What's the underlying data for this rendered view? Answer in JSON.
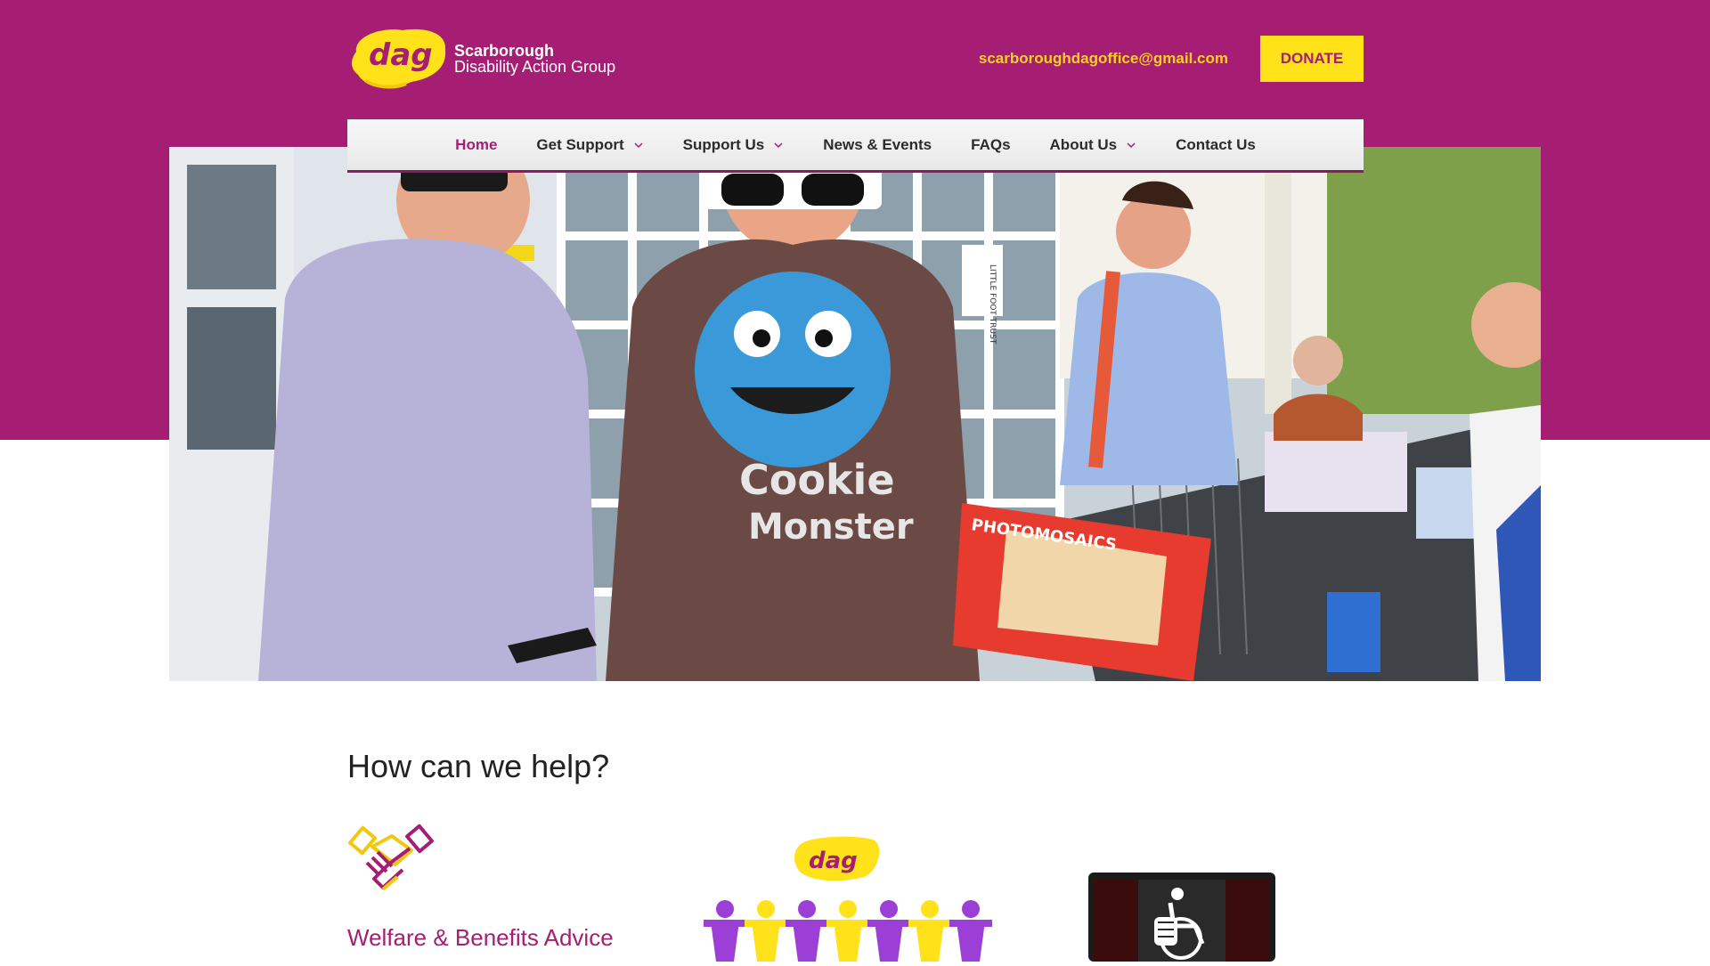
{
  "header": {
    "logo_badge": "dag",
    "logo_line1": "Scarborough",
    "logo_line2": "Disability Action Group",
    "email": "scarboroughdagoffice@gmail.com",
    "donate_label": "DONATE"
  },
  "nav": {
    "items": [
      {
        "label": "Home",
        "active": true,
        "has_dropdown": false
      },
      {
        "label": "Get Support",
        "active": false,
        "has_dropdown": true
      },
      {
        "label": "Support Us",
        "active": false,
        "has_dropdown": true
      },
      {
        "label": "News & Events",
        "active": false,
        "has_dropdown": false
      },
      {
        "label": "FAQs",
        "active": false,
        "has_dropdown": false
      },
      {
        "label": "About Us",
        "active": false,
        "has_dropdown": true
      },
      {
        "label": "Contact Us",
        "active": false,
        "has_dropdown": false
      }
    ]
  },
  "hero": {
    "shirt_text_1": "Cookie",
    "shirt_text_2": "Monster",
    "box_text": "PHOTOMOSAICS",
    "sign_text": "LITTLE FOOT TRUST"
  },
  "help": {
    "title": "How can we help?",
    "cards": [
      {
        "title": "Welfare & Benefits Advice",
        "icon": "handshake-icon"
      },
      {
        "title": "",
        "icon": "dag-people-chain-icon",
        "badge": "dag"
      },
      {
        "title": "",
        "icon": "wheelchair-fist-icon"
      }
    ]
  },
  "colors": {
    "brand_purple": "#a51e74",
    "brand_yellow": "#ffe21a",
    "email_yellow": "#ffd01f"
  }
}
